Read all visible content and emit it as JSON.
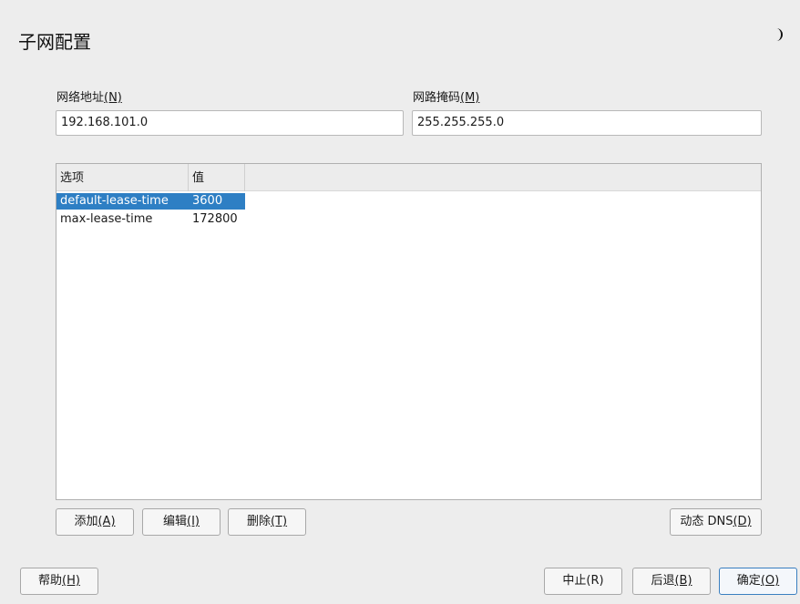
{
  "window": {
    "title": "子网配置"
  },
  "network": {
    "label": "网络地址",
    "mnemonic": "(N)",
    "value": "192.168.101.0"
  },
  "netmask": {
    "label": "网路掩码",
    "mnemonic": "(M)",
    "value": "255.255.255.0"
  },
  "options_table": {
    "columns": [
      "选项",
      "值"
    ],
    "rows": [
      {
        "option": "default-lease-time",
        "value": "3600",
        "selected": true
      },
      {
        "option": "max-lease-time",
        "value": "172800",
        "selected": false
      }
    ]
  },
  "table_buttons": {
    "add": {
      "text": "添加",
      "key": "(A)"
    },
    "edit": {
      "text": "编辑",
      "key": "(I)"
    },
    "delete": {
      "text": "删除",
      "key": "(T)"
    },
    "dynamic_dns": {
      "text": "动态 DNS",
      "key": "(D)"
    }
  },
  "footer": {
    "help": {
      "text": "帮助",
      "key": "(H)"
    },
    "abort": "中止(R)",
    "back": {
      "text": "后退",
      "key": "(B)"
    },
    "ok": {
      "text": "确定",
      "key": "(O)"
    }
  },
  "colors": {
    "selection": "#2e7fc4",
    "background": "#ededed",
    "default_border": "#3a7fc0"
  },
  "icons": {
    "top_right": "moon-icon"
  }
}
